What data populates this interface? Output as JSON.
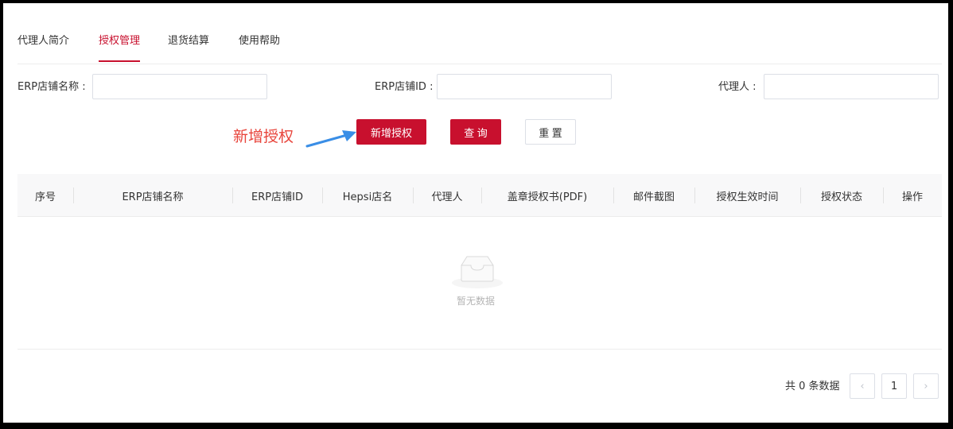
{
  "tabs": [
    {
      "label": "代理人简介"
    },
    {
      "label": "授权管理",
      "active": true
    },
    {
      "label": "退货结算"
    },
    {
      "label": "使用帮助"
    }
  ],
  "filters": {
    "shop_name_label": "ERP店铺名称 :",
    "shop_id_label": "ERP店铺ID :",
    "agent_label": "代理人 :"
  },
  "actions": {
    "annotation": "新增授权",
    "add_label": "新增授权",
    "query_label": "查 询",
    "reset_label": "重 置"
  },
  "table": {
    "columns": [
      "序号",
      "ERP店铺名称",
      "ERP店铺ID",
      "Hepsi店名",
      "代理人",
      "盖章授权书(PDF)",
      "邮件截图",
      "授权生效时间",
      "授权状态",
      "操作"
    ],
    "empty_text": "暂无数据"
  },
  "pagination": {
    "total_text": "共 0 条数据",
    "prev": "‹",
    "current_page": "1",
    "next": "›"
  },
  "colors": {
    "accent": "#c8102e",
    "annotation": "#e8453c",
    "arrow": "#3a8ee6"
  }
}
